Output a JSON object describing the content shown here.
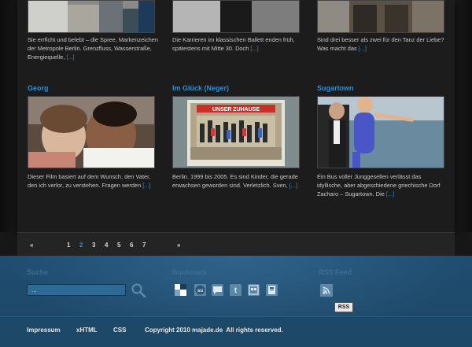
{
  "posts_top": [
    {
      "excerpt": "Sie errficht und belebt – die Spree, Markenzeichen der Metropole Berlin. Grenzfluss, Wasserstraße, Energiequelle,",
      "more": "[...]"
    },
    {
      "excerpt": "Die Karrieren im klassischen Ballett enden früh, spätestens mit Mitte 30. Doch",
      "more": "[...]"
    },
    {
      "excerpt": "Sind drei besser als zwei für den Tanz der Liebe? Was macht das",
      "more": "[...]"
    }
  ],
  "posts": [
    {
      "title": "Georg",
      "excerpt": "Dieser Film basiert auf dem Wunsch, den Vater, den ich verlor, zu verstehen. Fragen werden",
      "more": "[...]"
    },
    {
      "title": "Im Glück (Neger)",
      "excerpt": "Berlin. 1999 bis 2005. Es sind Kinder, die gerade erwachsen geworden sind. Verletzlich. Sven,",
      "more": "[...]",
      "sign_text": "UNSER ZUHAUSE"
    },
    {
      "title": "Sugartown",
      "excerpt": "Ein Bus voller Junggesellen verlässt das idyllische, aber abgeschiedene griechische Dorf Zacharo – Sugartown. Die",
      "more": "[...]"
    }
  ],
  "pagination": {
    "prev": "«",
    "pages": [
      "1",
      "2",
      "3",
      "4",
      "5",
      "6",
      "7"
    ],
    "current": "2",
    "next": "»"
  },
  "footer": {
    "search_heading": "Suche",
    "search_value": "...",
    "bookmark_heading": "Bookmark",
    "bookmark_icons": [
      "delicious-icon",
      "stumbleupon-icon",
      "comment-bubble-icon",
      "twitter-icon",
      "digg-icon",
      "bookmark-icon"
    ],
    "rss_heading": "RSS Feed",
    "rss_tooltip": "RSS",
    "links": [
      "Impressum",
      "xHTML",
      "CSS"
    ],
    "copyright": "Copyright 2010 majade.de  All rights reserved."
  },
  "colors": {
    "accent": "#2d8ed1",
    "footer_bg": "#1f4d70",
    "panel_bg": "#1c1c1c"
  }
}
